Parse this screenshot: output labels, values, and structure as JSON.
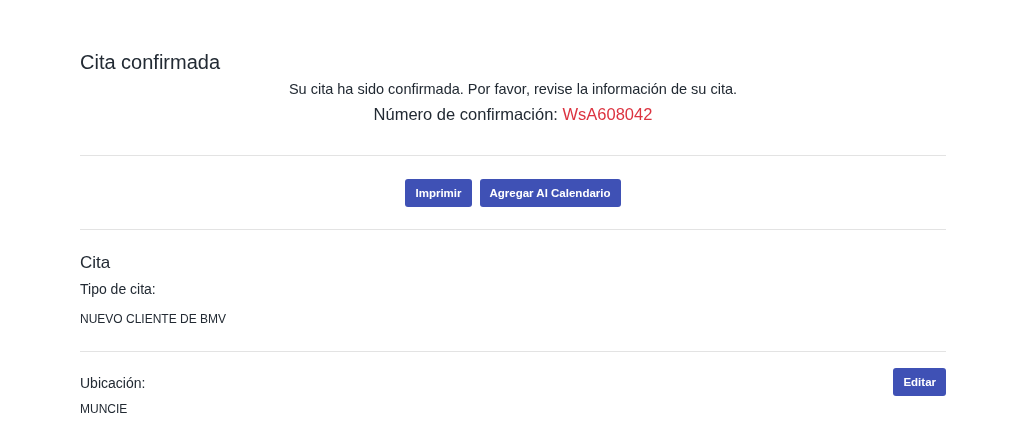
{
  "title": "Cita confirmada",
  "message": "Su cita ha sido confirmada. Por favor, revise la información de su cita.",
  "confirmation": {
    "label": "Número de confirmación:",
    "number": "WsA608042"
  },
  "actions": [
    "Imprimir",
    "Agregar Al Calendario"
  ],
  "section": {
    "title": "Cita",
    "fields": [
      {
        "label": "Tipo de cita:",
        "value": "NUEVO CLIENTE DE BMV"
      },
      {
        "label": "Ubicación:",
        "value": "MUNCIE",
        "action": "Editar"
      }
    ]
  }
}
